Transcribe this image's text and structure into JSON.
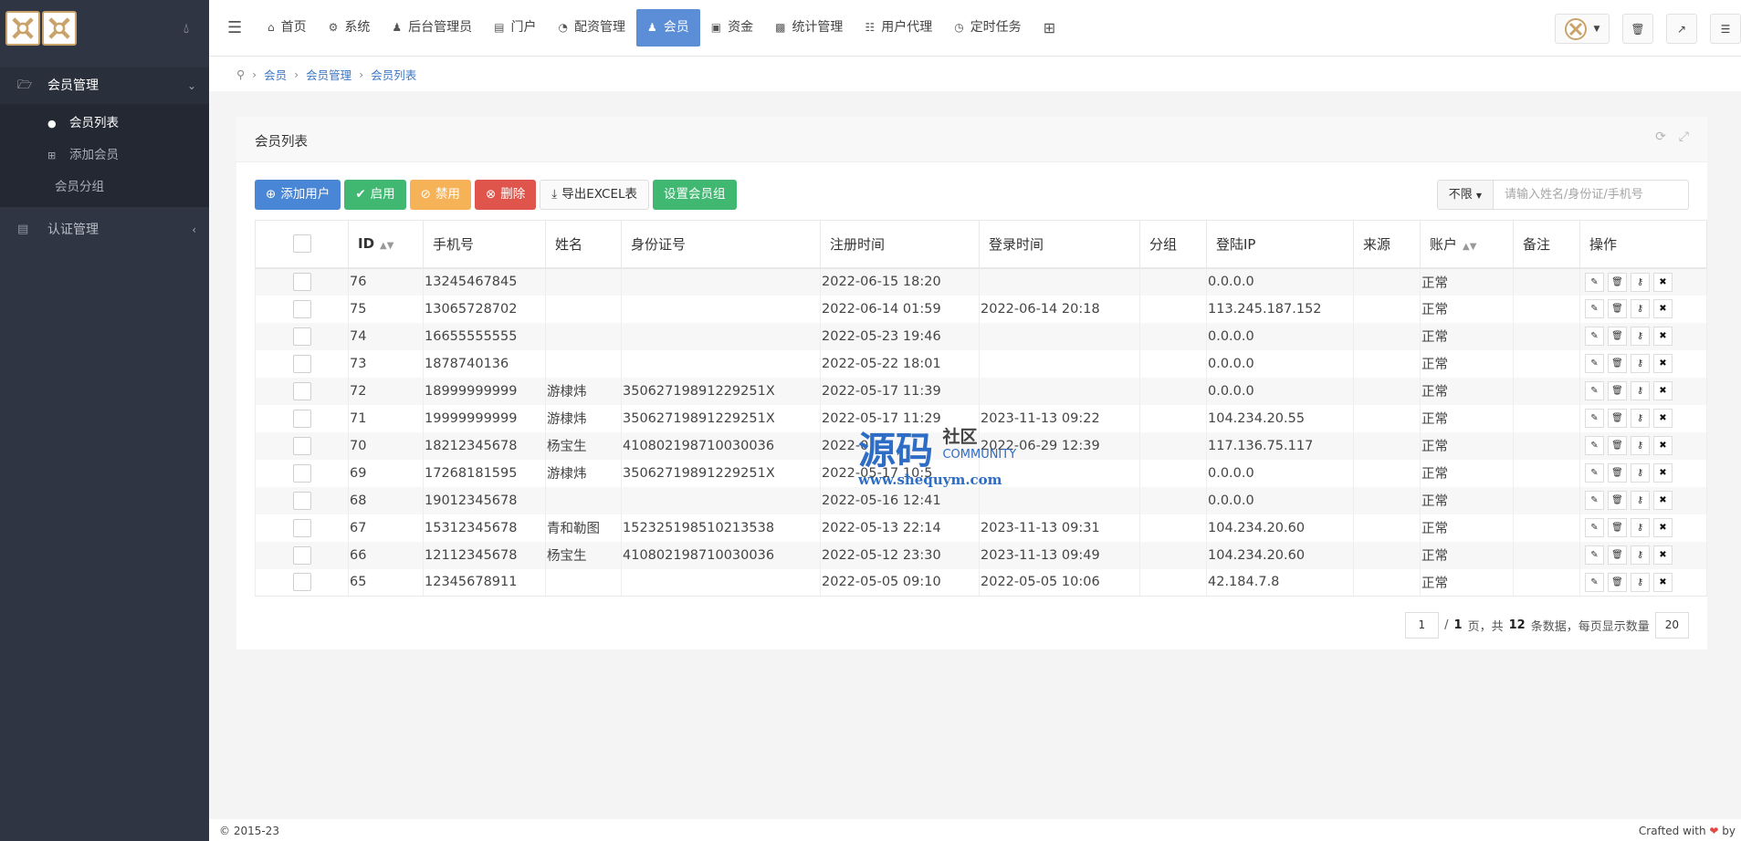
{
  "sidebar": {
    "groups": [
      {
        "label": "会员管理",
        "arrow": "⌄"
      },
      {
        "label": "认证管理",
        "arrow": "‹"
      }
    ],
    "items": [
      {
        "label": "会员列表"
      },
      {
        "label": "添加会员"
      },
      {
        "label": "会员分组"
      }
    ]
  },
  "topnav": {
    "items": [
      {
        "label": "首页"
      },
      {
        "label": "系统"
      },
      {
        "label": "后台管理员"
      },
      {
        "label": "门户"
      },
      {
        "label": "配资管理"
      },
      {
        "label": "会员"
      },
      {
        "label": "资金"
      },
      {
        "label": "统计管理"
      },
      {
        "label": "用户代理"
      },
      {
        "label": "定时任务"
      }
    ],
    "active": "会员"
  },
  "breadcrumb": [
    "会员",
    "会员管理",
    "会员列表"
  ],
  "panel": {
    "title": "会员列表"
  },
  "toolbar": {
    "add": "添加用户",
    "enable": "启用",
    "disable": "禁用",
    "delete": "删除",
    "export": "导出EXCEL表",
    "group": "设置会员组"
  },
  "search": {
    "filter": "不限",
    "placeholder": "请输入姓名/身份证/手机号"
  },
  "table": {
    "headers": [
      "ID",
      "手机号",
      "姓名",
      "身份证号",
      "注册时间",
      "登录时间",
      "分组",
      "登陆IP",
      "来源",
      "账户",
      "备注",
      "操作"
    ],
    "rows": [
      {
        "id": "76",
        "phone": "13245467845",
        "name": "",
        "idcard": "",
        "reg": "2022-06-15 18:20",
        "login": "",
        "group": "",
        "ip": "0.0.0.0",
        "src": "",
        "acct": "正常",
        "note": ""
      },
      {
        "id": "75",
        "phone": "13065728702",
        "name": "",
        "idcard": "",
        "reg": "2022-06-14 01:59",
        "login": "2022-06-14 20:18",
        "group": "",
        "ip": "113.245.187.152",
        "src": "",
        "acct": "正常",
        "note": ""
      },
      {
        "id": "74",
        "phone": "16655555555",
        "name": "",
        "idcard": "",
        "reg": "2022-05-23 19:46",
        "login": "",
        "group": "",
        "ip": "0.0.0.0",
        "src": "",
        "acct": "正常",
        "note": ""
      },
      {
        "id": "73",
        "phone": "1878740136",
        "name": "",
        "idcard": "",
        "reg": "2022-05-22 18:01",
        "login": "",
        "group": "",
        "ip": "0.0.0.0",
        "src": "",
        "acct": "正常",
        "note": ""
      },
      {
        "id": "72",
        "phone": "18999999999",
        "name": "游棣炜",
        "idcard": "35062719891229251X",
        "reg": "2022-05-17 11:39",
        "login": "",
        "group": "",
        "ip": "0.0.0.0",
        "src": "",
        "acct": "正常",
        "note": ""
      },
      {
        "id": "71",
        "phone": "19999999999",
        "name": "游棣炜",
        "idcard": "35062719891229251X",
        "reg": "2022-05-17 11:29",
        "login": "2023-11-13 09:22",
        "group": "",
        "ip": "104.234.20.55",
        "src": "",
        "acct": "正常",
        "note": ""
      },
      {
        "id": "70",
        "phone": "18212345678",
        "name": "杨宝生",
        "idcard": "410802198710030036",
        "reg": "2022-0",
        "login": "2022-06-29 12:39",
        "group": "",
        "ip": "117.136.75.117",
        "src": "",
        "acct": "正常",
        "note": ""
      },
      {
        "id": "69",
        "phone": "17268181595",
        "name": "游棣炜",
        "idcard": "35062719891229251X",
        "reg": "2022-05-17 10:5",
        "login": "",
        "group": "",
        "ip": "0.0.0.0",
        "src": "",
        "acct": "正常",
        "note": ""
      },
      {
        "id": "68",
        "phone": "19012345678",
        "name": "",
        "idcard": "",
        "reg": "2022-05-16 12:41",
        "login": "",
        "group": "",
        "ip": "0.0.0.0",
        "src": "",
        "acct": "正常",
        "note": ""
      },
      {
        "id": "67",
        "phone": "15312345678",
        "name": "青和勒图",
        "idcard": "152325198510213538",
        "reg": "2022-05-13 22:14",
        "login": "2023-11-13 09:31",
        "group": "",
        "ip": "104.234.20.60",
        "src": "",
        "acct": "正常",
        "note": ""
      },
      {
        "id": "66",
        "phone": "12112345678",
        "name": "杨宝生",
        "idcard": "410802198710030036",
        "reg": "2022-05-12 23:30",
        "login": "2023-11-13 09:49",
        "group": "",
        "ip": "104.234.20.60",
        "src": "",
        "acct": "正常",
        "note": ""
      },
      {
        "id": "65",
        "phone": "12345678911",
        "name": "",
        "idcard": "",
        "reg": "2022-05-05 09:10",
        "login": "2022-05-05 10:06",
        "group": "",
        "ip": "42.184.7.8",
        "src": "",
        "acct": "正常",
        "note": ""
      }
    ]
  },
  "pager": {
    "page": "1",
    "info_a": "/",
    "total_pages": "1",
    "info_b": "页，共",
    "total_rows": "12",
    "info_c": "条数据，每页显示数量",
    "per_page": "20"
  },
  "watermark": {
    "big": "源码",
    "she": "社区",
    "community": "COMMUNITY",
    "url": "www.shequym.com"
  },
  "footer": {
    "copyright": "© 2015-23",
    "crafted": "Crafted with",
    "by": "by"
  },
  "colors": {
    "sidebar": "#2f3542",
    "accent": "#5b8ed6",
    "green": "#40b872",
    "orange": "#f6b257",
    "red": "#e0554b"
  }
}
